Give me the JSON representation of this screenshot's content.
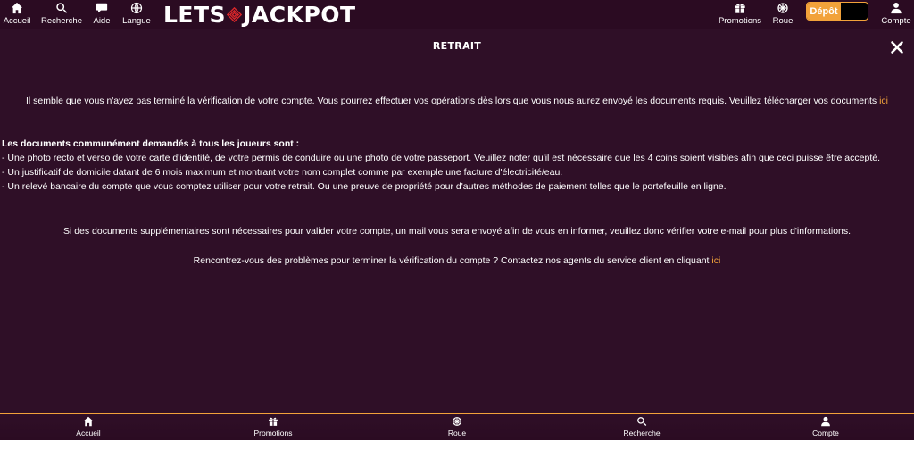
{
  "top_nav": {
    "home": "Accueil",
    "search": "Recherche",
    "help": "Aide",
    "language": "Langue",
    "promotions": "Promotions",
    "wheel": "Roue",
    "account": "Compte"
  },
  "logo_text": {
    "left": "LETS",
    "right": "JACKPOT"
  },
  "deposit": {
    "label": "Dépôt"
  },
  "modal": {
    "title": "RETRAIT",
    "intro": "Il semble que vous n'ayez pas terminé la vérification de votre compte. Vous pourrez effectuer vos opérations dès lors que vous nous aurez envoyé les documents requis. Veuillez télécharger vos documents ",
    "intro_link": "ici",
    "docs_heading": "Les documents communément demandés à tous les joueurs sont :",
    "docs": [
      "- Une photo recto et verso de votre carte d'identité, de votre permis de conduire ou une photo de votre passeport. Veuillez noter qu'il est nécessaire que les 4 coins soient visibles afin que ceci puisse être accepté.",
      "- Un justificatif de domicile datant de 6 mois maximum et montrant votre nom complet comme par exemple une facture d'électricité/eau.",
      "- Un relevé bancaire du compte que vous comptez utiliser pour votre retrait. Ou une preuve de propriété pour d'autres méthodes de paiement telles que le portefeuille en ligne."
    ],
    "extra_info": "Si des documents supplémentaires sont nécessaires pour valider votre compte, un mail vous sera envoyé afin de vous en informer, veuillez donc vérifier votre e-mail pour plus d'informations.",
    "contact": "Rencontrez-vous des problèmes pour terminer la vérification du compte ? Contactez nos agents du service client en cliquant ",
    "contact_link": "ici"
  },
  "bottom_nav": {
    "home": "Accueil",
    "promotions": "Promotions",
    "wheel": "Roue",
    "search": "Recherche",
    "account": "Compte"
  },
  "colors": {
    "background": "#2f0f27",
    "topbar": "#2b0b22",
    "accent": "#f2a23a",
    "logo_mark": "#d9262a"
  },
  "icons": [
    "home-icon",
    "search-icon",
    "chat-icon",
    "globe-icon",
    "gift-icon",
    "wheel-icon",
    "user-icon",
    "close-icon"
  ]
}
